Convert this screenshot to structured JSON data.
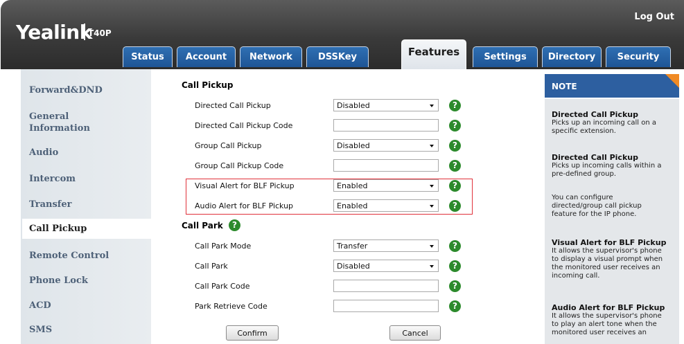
{
  "header": {
    "brand": "Yealink",
    "model": "T40P",
    "logout": "Log Out",
    "tabs": [
      "Status",
      "Account",
      "Network",
      "DSSKey",
      "Features",
      "Settings",
      "Directory",
      "Security"
    ],
    "active_tab": "Features"
  },
  "sidebar": {
    "items": [
      "Forward&DND",
      "General Information",
      "Audio",
      "Intercom",
      "Transfer",
      "Call Pickup",
      "Remote Control",
      "Phone Lock",
      "ACD",
      "SMS"
    ],
    "active_item": "Call Pickup"
  },
  "call_pickup": {
    "title": "Call Pickup",
    "rows": [
      {
        "label": "Directed Call Pickup",
        "type": "select",
        "value": "Disabled"
      },
      {
        "label": "Directed Call Pickup Code",
        "type": "text",
        "value": ""
      },
      {
        "label": "Group Call Pickup",
        "type": "select",
        "value": "Disabled"
      },
      {
        "label": "Group Call Pickup Code",
        "type": "text",
        "value": ""
      },
      {
        "label": "Visual Alert for BLF Pickup",
        "type": "select",
        "value": "Enabled"
      },
      {
        "label": "Audio Alert for BLF Pickup",
        "type": "select",
        "value": "Enabled"
      }
    ]
  },
  "call_park": {
    "title": "Call Park",
    "rows": [
      {
        "label": "Call Park Mode",
        "type": "select",
        "value": "Transfer"
      },
      {
        "label": "Call Park",
        "type": "select",
        "value": "Disabled"
      },
      {
        "label": "Call Park Code",
        "type": "text",
        "value": ""
      },
      {
        "label": "Park Retrieve Code",
        "type": "text",
        "value": ""
      }
    ]
  },
  "help_glyph": "?",
  "buttons": {
    "confirm": "Confirm",
    "cancel": "Cancel"
  },
  "note": {
    "title": "NOTE",
    "sections": [
      {
        "title": "Directed Call Pickup",
        "lines": [
          "Picks up an incoming call on a",
          "specific extension."
        ]
      },
      {
        "title": "Directed Call Pickup",
        "lines": [
          "Picks up incoming calls within a",
          "pre-defined group."
        ]
      },
      {
        "title": "",
        "lines": [
          "You can configure",
          "directed/group call pickup",
          "feature for the IP phone."
        ]
      },
      {
        "title": "Visual Alert for BLF Pickup",
        "lines": [
          "It allows the supervisor's phone",
          "to display a visual prompt when",
          "the monitored user receives an",
          "incoming call."
        ]
      },
      {
        "title": "Audio Alert for BLF Pickup",
        "lines": [
          "It allows the supervisor's phone",
          "to play an alert tone when the",
          "monitored user receives an"
        ]
      }
    ]
  },
  "colors": {
    "tab_blue": "#1e5596",
    "note_blue": "#2d5fa0",
    "note_corner": "#f08a24",
    "help_green": "#2c8a2c",
    "highlight_red": "#e0303a"
  }
}
